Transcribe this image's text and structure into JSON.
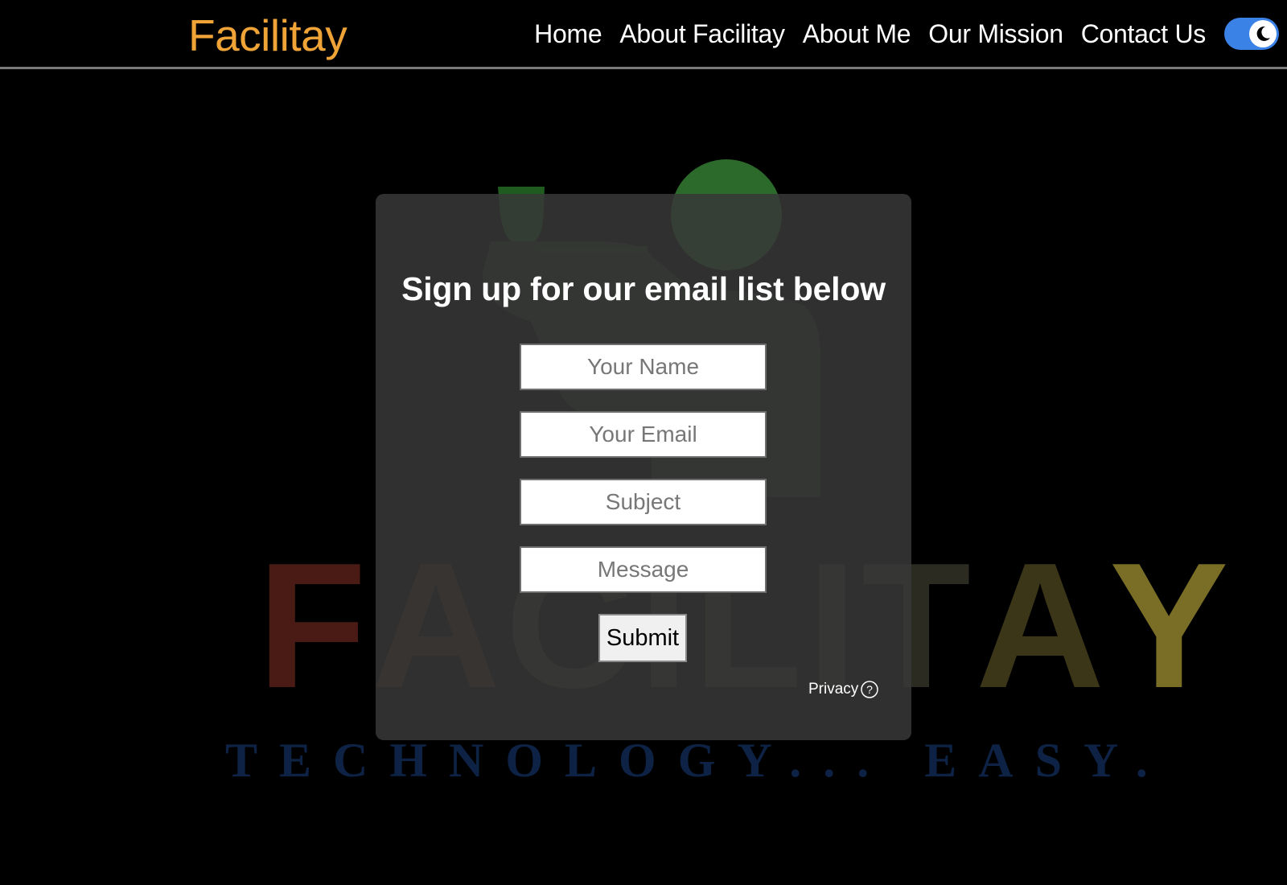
{
  "brand": {
    "name": "Facilitay",
    "color": "#f0a336"
  },
  "nav": {
    "links": [
      {
        "label": "Home"
      },
      {
        "label": "About Facilitay"
      },
      {
        "label": "About Me"
      },
      {
        "label": "Our Mission"
      },
      {
        "label": "Contact Us"
      }
    ],
    "theme_toggle": {
      "icon": "moon-icon",
      "state": "dark",
      "color": "#3b82e6"
    }
  },
  "background_logo": {
    "word": "FACILITAY",
    "tagline": "TECHNOLOGY... EASY.",
    "letter_colors": [
      "#4a1a14",
      "#3a2214",
      "#2e2a1c",
      "#2b2b22",
      "#2b2b22",
      "#2b2b22",
      "#2b2b22",
      "#3c3619",
      "#7a6e27"
    ],
    "icon": "person-with-tray-icon"
  },
  "form": {
    "title": "Sign up for our email list below",
    "fields": {
      "name": {
        "placeholder": "Your Name",
        "value": ""
      },
      "email": {
        "placeholder": "Your Email",
        "value": ""
      },
      "subject": {
        "placeholder": "Subject",
        "value": ""
      },
      "message": {
        "placeholder": "Message",
        "value": ""
      }
    },
    "submit_label": "Submit",
    "privacy_label": "Privacy",
    "privacy_icon": "question-circle-icon"
  }
}
